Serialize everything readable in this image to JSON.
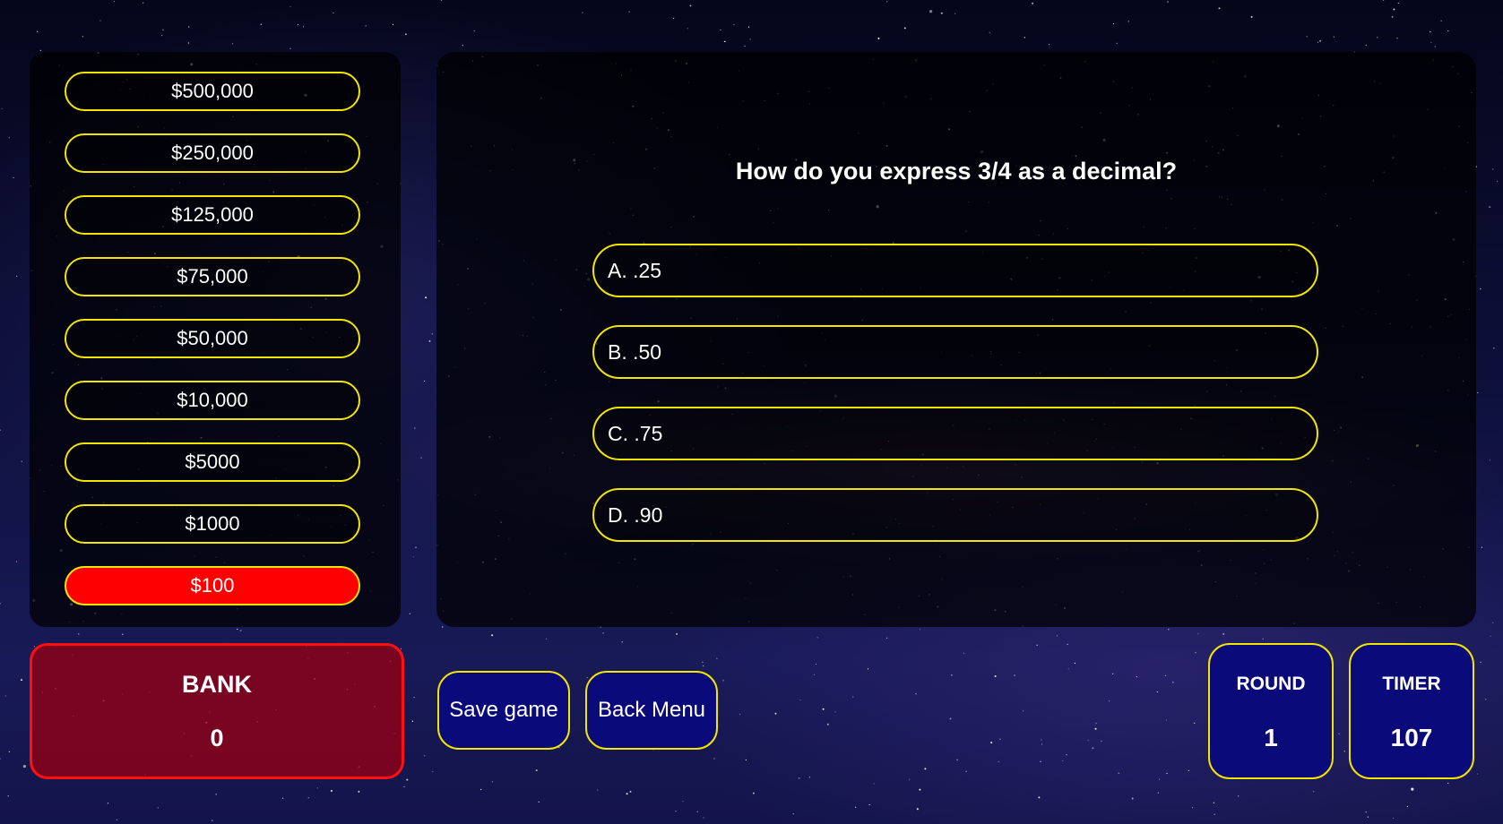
{
  "colors": {
    "accent_border": "#f2e600",
    "active_prize": "#ff0000",
    "bank_bg": "#96001a",
    "button_bg": "#0a0a7a"
  },
  "ladder": {
    "prizes": [
      "$500,000",
      "$250,000",
      "$125,000",
      "$75,000",
      "$50,000",
      "$10,000",
      "$5000",
      "$1000",
      "$100"
    ],
    "active_index": 8
  },
  "question": {
    "text": "How do you express 3/4 as a decimal?",
    "answers": [
      "A. .25",
      "B. .50",
      "C. .75",
      "D. .90"
    ]
  },
  "bank": {
    "label": "BANK",
    "value": "0"
  },
  "buttons": {
    "save": "Save game",
    "back": "Back Menu"
  },
  "round": {
    "label": "ROUND",
    "value": "1"
  },
  "timer": {
    "label": "TIMER",
    "value": "107"
  }
}
